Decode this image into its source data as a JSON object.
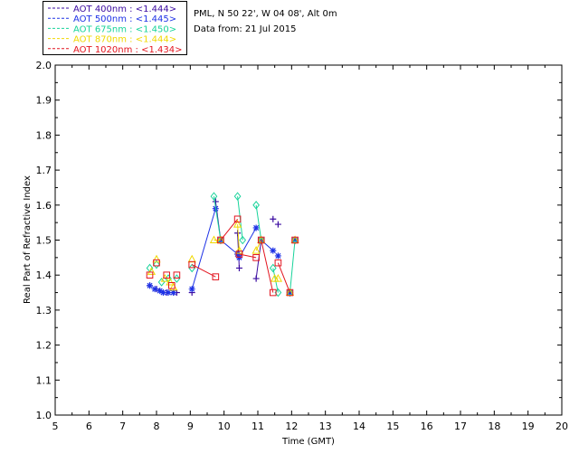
{
  "info": {
    "site_line": "PML, N 50 22', W 04 08', Alt 0m",
    "date_line": "Data from: 21 Jul 2015"
  },
  "chart_data": {
    "type": "scatter",
    "title": "",
    "xlabel": "Time (GMT)",
    "ylabel": "Real Part of Refractive Index",
    "xlim": [
      5,
      20
    ],
    "ylim": [
      1.0,
      2.0
    ],
    "x_ticks": [
      5,
      6,
      7,
      8,
      9,
      10,
      11,
      12,
      13,
      14,
      15,
      16,
      17,
      18,
      19,
      20
    ],
    "y_ticks": [
      "1.0",
      "1.1",
      "1.2",
      "1.3",
      "1.4",
      "1.5",
      "1.6",
      "1.7",
      "1.8",
      "1.9",
      "2.0"
    ],
    "grid": false,
    "legend_position": "top-left, outside plot",
    "series": [
      {
        "name": "AOT  400nm : <1.444>",
        "color": "#3a0aa0",
        "marker": "plus",
        "connect": [
          [
            6,
            7
          ],
          [
            8,
            9
          ],
          [
            10,
            11
          ]
        ],
        "points": [
          [
            7.8,
            1.37
          ],
          [
            8.0,
            1.36
          ],
          [
            8.3,
            1.35
          ],
          [
            8.5,
            1.35
          ],
          [
            8.6,
            1.35
          ],
          [
            9.05,
            1.35
          ],
          [
            9.75,
            1.61
          ],
          [
            9.9,
            1.5
          ],
          [
            10.4,
            1.52
          ],
          [
            10.45,
            1.42
          ],
          [
            10.95,
            1.39
          ],
          [
            11.1,
            1.5
          ],
          [
            11.45,
            1.56
          ],
          [
            11.6,
            1.545
          ]
        ]
      },
      {
        "name": "AOT  500nm : <1.445>",
        "color": "#1e32e6",
        "marker": "asterisk",
        "connect": [
          [
            6,
            7
          ],
          [
            8,
            9
          ],
          [
            10,
            11
          ],
          [
            12,
            13
          ]
        ],
        "points": [
          [
            7.8,
            1.37
          ],
          [
            7.95,
            1.36
          ],
          [
            8.1,
            1.355
          ],
          [
            8.2,
            1.35
          ],
          [
            8.35,
            1.35
          ],
          [
            8.5,
            1.35
          ],
          [
            9.05,
            1.36
          ],
          [
            9.75,
            1.59
          ],
          [
            9.9,
            1.5
          ],
          [
            10.4,
            1.46
          ],
          [
            10.45,
            1.45
          ],
          [
            10.95,
            1.535
          ],
          [
            11.1,
            1.5
          ],
          [
            11.45,
            1.47
          ],
          [
            11.6,
            1.455
          ],
          [
            11.95,
            1.35
          ],
          [
            12.1,
            1.5
          ]
        ]
      },
      {
        "name": "AOT  675nm : <1.450>",
        "color": "#17d39a",
        "marker": "diamond",
        "connect": [
          [
            6,
            7
          ],
          [
            8,
            9
          ],
          [
            10,
            11
          ],
          [
            12,
            13
          ],
          [
            14,
            15
          ]
        ],
        "points": [
          [
            7.8,
            1.42
          ],
          [
            8.0,
            1.43
          ],
          [
            8.15,
            1.38
          ],
          [
            8.35,
            1.39
          ],
          [
            8.6,
            1.39
          ],
          [
            9.05,
            1.42
          ],
          [
            9.7,
            1.625
          ],
          [
            9.9,
            1.5
          ],
          [
            10.4,
            1.625
          ],
          [
            10.55,
            1.5
          ],
          [
            10.95,
            1.6
          ],
          [
            11.1,
            1.5
          ],
          [
            11.45,
            1.42
          ],
          [
            11.6,
            1.35
          ],
          [
            11.95,
            1.35
          ],
          [
            12.1,
            1.5
          ]
        ]
      },
      {
        "name": "AOT  870nm : <1.444>",
        "color": "#f0d800",
        "marker": "triangle",
        "connect": [
          [
            6,
            7
          ],
          [
            8,
            9
          ],
          [
            10,
            11
          ],
          [
            12,
            13
          ]
        ],
        "points": [
          [
            7.85,
            1.41
          ],
          [
            8.0,
            1.445
          ],
          [
            8.25,
            1.39
          ],
          [
            8.4,
            1.38
          ],
          [
            8.5,
            1.365
          ],
          [
            9.05,
            1.445
          ],
          [
            9.7,
            1.5
          ],
          [
            9.9,
            1.5
          ],
          [
            10.4,
            1.545
          ],
          [
            10.45,
            1.47
          ],
          [
            10.95,
            1.47
          ],
          [
            11.1,
            1.5
          ],
          [
            11.5,
            1.39
          ],
          [
            11.6,
            1.39
          ],
          [
            11.95,
            1.35
          ],
          [
            12.1,
            1.5
          ]
        ]
      },
      {
        "name": "AOT 1020nm : <1.434>",
        "color": "#e3141e",
        "marker": "square",
        "connect": [
          [
            5,
            6
          ],
          [
            7,
            8
          ],
          [
            9,
            10
          ],
          [
            11,
            12
          ],
          [
            13,
            14
          ]
        ],
        "points": [
          [
            7.8,
            1.4
          ],
          [
            8.0,
            1.435
          ],
          [
            8.3,
            1.4
          ],
          [
            8.45,
            1.37
          ],
          [
            8.6,
            1.4
          ],
          [
            9.05,
            1.43
          ],
          [
            9.75,
            1.395
          ],
          [
            9.9,
            1.5
          ],
          [
            10.4,
            1.56
          ],
          [
            10.45,
            1.46
          ],
          [
            10.95,
            1.45
          ],
          [
            11.1,
            1.5
          ],
          [
            11.45,
            1.35
          ],
          [
            11.6,
            1.435
          ],
          [
            11.95,
            1.35
          ],
          [
            12.1,
            1.5
          ]
        ]
      }
    ]
  }
}
